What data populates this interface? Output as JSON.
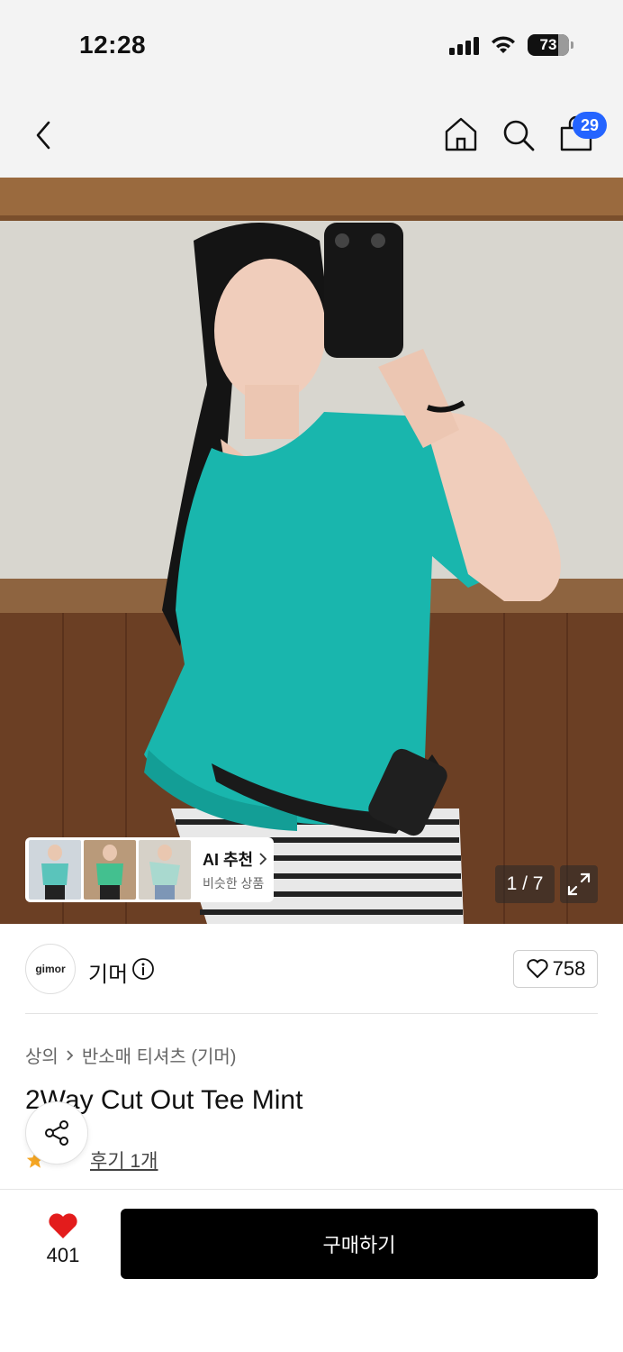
{
  "status_bar": {
    "time": "12:28",
    "battery": "73"
  },
  "header": {
    "cart_count": "29"
  },
  "gallery": {
    "ai_title": "AI 추천",
    "ai_subtitle": "비슷한 상품",
    "page_indicator": "1 / 7"
  },
  "brand": {
    "logo_text": "gimor",
    "name": "기머",
    "likes": "758"
  },
  "breadcrumb": {
    "category": "상의",
    "subcategory": "반소매 티셔츠 (기머)"
  },
  "product": {
    "title": "2Way Cut Out Tee Mint",
    "review_link": "후기 1개"
  },
  "bottom_bar": {
    "wish_count": "401",
    "buy_label": "구매하기"
  },
  "colors": {
    "accent_blue": "#2464ff",
    "heart_red": "#e31c1c",
    "shirt_mint": "#19b6ad"
  }
}
